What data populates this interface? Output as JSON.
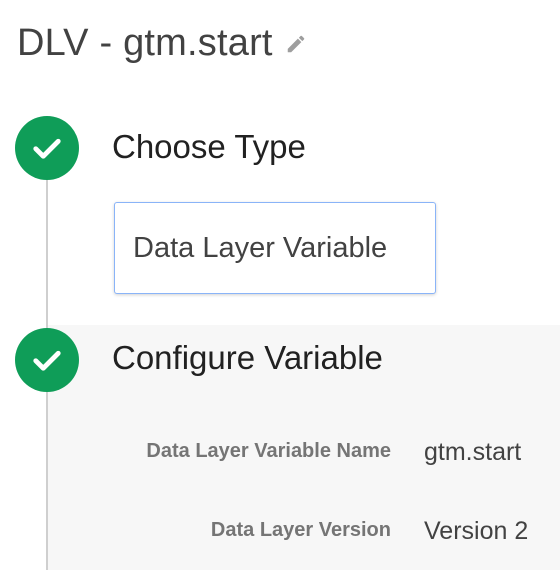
{
  "header": {
    "title": "DLV - gtm.start",
    "edit_icon": "pencil-icon"
  },
  "steps": [
    {
      "title": "Choose Type",
      "status_icon": "check-icon",
      "selected_type": "Data Layer Variable"
    },
    {
      "title": "Configure Variable",
      "status_icon": "check-icon",
      "fields": [
        {
          "label": "Data Layer Variable Name",
          "value": "gtm.start"
        },
        {
          "label": "Data Layer Version",
          "value": "Version 2"
        }
      ]
    }
  ],
  "colors": {
    "step_complete": "#0f9d58",
    "type_box_border": "#8ab4f8",
    "config_panel_bg": "#f7f7f7"
  }
}
